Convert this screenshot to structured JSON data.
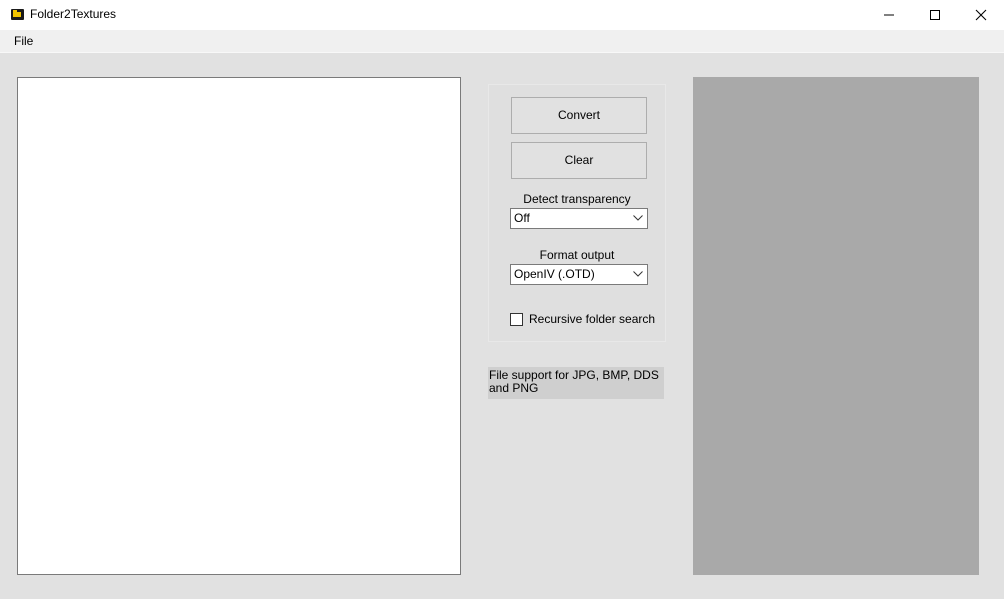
{
  "window": {
    "title": "Folder2Textures",
    "icon": "folder-icon"
  },
  "menu": {
    "file_label": "File"
  },
  "controls": {
    "convert_label": "Convert",
    "clear_label": "Clear",
    "detect_transparency_label": "Detect transparency",
    "detect_transparency_value": "Off",
    "format_output_label": "Format output",
    "format_output_value": "OpenIV (.OTD)",
    "recursive_label": "Recursive folder search",
    "recursive_checked": false
  },
  "info": {
    "file_support": "File support for JPG, BMP, DDS and PNG"
  },
  "colors": {
    "preview_bg": "#a9a9a9",
    "window_bg": "#e1e1e1",
    "icon_yellow": "#f2c400"
  }
}
